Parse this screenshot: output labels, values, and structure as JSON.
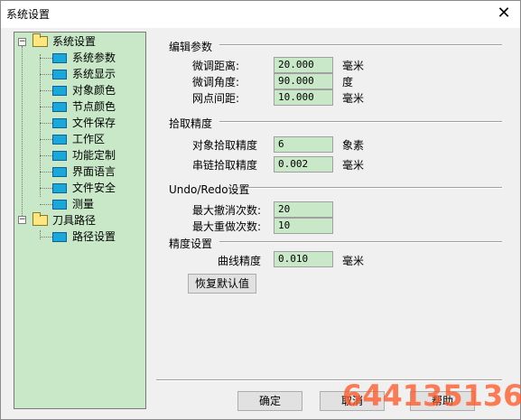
{
  "window": {
    "title": "系统设置",
    "close_glyph": "✕"
  },
  "tree": {
    "root1": {
      "label": "系统设置",
      "expander": "−",
      "children": [
        "系统参数",
        "系统显示",
        "对象颜色",
        "节点颜色",
        "文件保存",
        "工作区",
        "功能定制",
        "界面语言",
        "文件安全",
        "测量"
      ]
    },
    "root2": {
      "label": "刀具路径",
      "expander": "−",
      "children": [
        "路径设置"
      ]
    }
  },
  "sections": {
    "edit": {
      "title": "编辑参数",
      "rows": [
        {
          "label": "微调距离:",
          "value": "20.000",
          "unit": "毫米"
        },
        {
          "label": "微调角度:",
          "value": "90.000",
          "unit": "度"
        },
        {
          "label": "网点间距:",
          "value": "10.000",
          "unit": "毫米"
        }
      ]
    },
    "pick": {
      "title": "拾取精度",
      "rows": [
        {
          "label": "对象拾取精度",
          "value": "6",
          "unit": "象素"
        },
        {
          "label": "串链拾取精度",
          "value": "0.002",
          "unit": "毫米"
        }
      ]
    },
    "undo": {
      "title": "Undo/Redo设置",
      "rows": [
        {
          "label": "最大撤消次数:",
          "value": "20"
        },
        {
          "label": "最大重做次数:",
          "value": "10"
        }
      ]
    },
    "precision": {
      "title": "精度设置",
      "rows": [
        {
          "label": "曲线精度",
          "value": "0.010",
          "unit": "毫米"
        }
      ]
    }
  },
  "buttons": {
    "restore": "恢复默认值",
    "ok": "确定",
    "cancel": "取消",
    "help": "帮助"
  },
  "watermark": "644135136"
}
